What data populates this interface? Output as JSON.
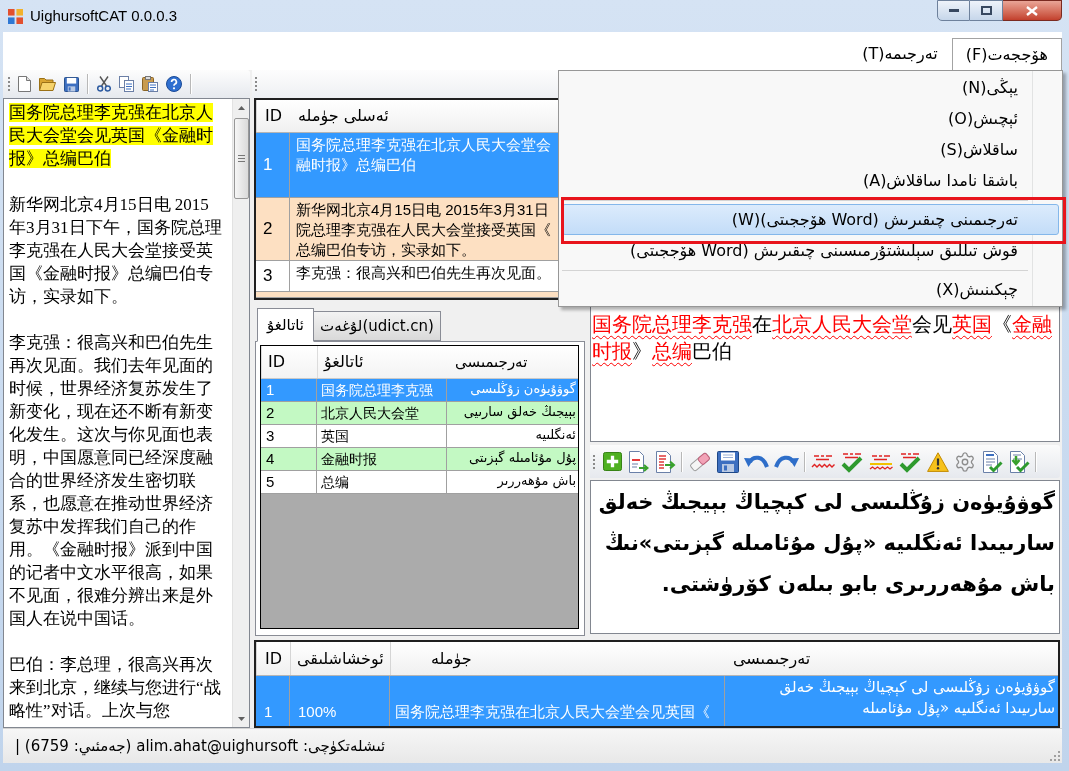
{
  "window": {
    "title": "UighursoftCAT 0.0.0.3"
  },
  "menu_bar": [
    {
      "label": "ھۆججەت(F)",
      "selected": true
    },
    {
      "label": "تەرجىمە(T)",
      "selected": false
    }
  ],
  "open_menu": {
    "items": [
      {
        "kind": "item",
        "label": "يېڭى(N)",
        "selected": false,
        "outlined": false
      },
      {
        "kind": "item",
        "label": "ئېچىش(O)",
        "selected": false,
        "outlined": false
      },
      {
        "kind": "item",
        "label": "ساقلاش(S)",
        "selected": false,
        "outlined": false
      },
      {
        "kind": "item",
        "label": "باشقا نامدا ساقلاش(A)",
        "selected": false,
        "outlined": false
      },
      {
        "kind": "separator"
      },
      {
        "kind": "item",
        "label": "تەرجىمىنى چىقىرىش (Word ھۆججىتى)(W)",
        "selected": true,
        "outlined": true
      },
      {
        "kind": "item",
        "label": "قوش تىللىق سېلىشتۇرمىسىنى چىقىرىش (Word ھۆججىتى)",
        "selected": false,
        "outlined": false
      },
      {
        "kind": "separator"
      },
      {
        "kind": "item",
        "label": "چېكىنىش(X)",
        "selected": false,
        "outlined": false
      }
    ]
  },
  "source_document": {
    "paragraphs": [
      {
        "text": "国务院总理李克强在北京人民大会堂会见英国《金融时报》总编巴伯",
        "highlighted": true
      },
      {
        "text": "新华网北京4月15日电 2015年3月31日下午，国务院总理李克强在人民大会堂接受英国《金融时报》总编巴伯专访，实录如下。",
        "highlighted": false
      },
      {
        "text": "李克强：很高兴和巴伯先生再次见面。我们去年见面的时候，世界经济复苏发生了新变化，现在还不断有新变化发生。这次与你见面也表明，中国愿意同已经深度融合的世界经济发生密切联系，也愿意在推动世界经济复苏中发挥我们自己的作用。《金融时报》派到中国的记者中文水平很高，如果不见面，很难分辨出来是外国人在说中国话。",
        "highlighted": false
      },
      {
        "text": "巴伯：李总理，很高兴再次来到北京，继续与您进行“战略性”对话。上次与您",
        "highlighted": false
      }
    ]
  },
  "segments_table": {
    "columns": [
      "ئەسلى جۈملە",
      "ID"
    ],
    "rows": [
      {
        "id": "1",
        "lines": [
          "国务院总理李克强在北京人民大会堂会",
          "融时报》总编巴伯"
        ],
        "selected": true
      },
      {
        "id": "2",
        "lines": [
          "新华网北京4月15日电 2015年3月31日",
          "院总理李克强在人民大会堂接受英国《",
          "总编巴伯专访，实录如下。"
        ],
        "selected": false
      },
      {
        "id": "3",
        "lines": [
          "李克强：很高兴和巴伯先生再次见面。"
        ],
        "selected": false
      },
      {
        "selected": false
      }
    ]
  },
  "terms_panel": {
    "tabs": [
      {
        "label": "لۇغەت(udict.cn)",
        "selected": false
      },
      {
        "label": "ئاتالغۇ",
        "selected": true
      }
    ],
    "columns": [
      "تەرجىمىسى",
      "ئاتالغۇ",
      "ID"
    ],
    "rows": [
      {
        "id": "1",
        "term": "国务院总理李克强",
        "translation": "گوۋۇيۈەن زۇڭلىسى",
        "selected": true
      },
      {
        "id": "2",
        "term": "北京人民大会堂",
        "translation": "بېيجىڭ خەلق سارىيى",
        "selected": false
      },
      {
        "id": "3",
        "term": "英国",
        "translation": "ئەنگلىيە",
        "selected": false
      },
      {
        "id": "4",
        "term": "金融时报",
        "translation": "پۇل مۇئامىلە گېزىتى",
        "selected": false
      },
      {
        "id": "5",
        "term": "总编",
        "translation": "باش مۇھەررىر",
        "selected": false
      }
    ]
  },
  "source_segment": {
    "text": "**国务院总理李克强**在**北京人民大会堂**会见**英国**《**金融时报**》**总编**巴伯"
  },
  "target_segment": {
    "text": "گوۋۇيۈەن زۇڭلىسى لى كېچياڭ بېيجىڭ خەلق سارىيىدا ئەنگلىيە «پۇل مۇئامىلە گېزىتى»نىڭ باش مۇھەررىرى بابو بىلەن كۆرۈشتى."
  },
  "matches_table": {
    "columns": [
      "تەرجىمىسى",
      "جۈملە",
      "ئوخشاشلىقى",
      "ID"
    ],
    "rows": [
      {
        "id": "1",
        "similarity": "100%",
        "sentence": "国务院总理李克强在北京人民大会堂会见英国《",
        "translation_lines": [
          "گوۋۇيۈەن زۇڭلىسى لى كېچياڭ بېيجىڭ خەلق",
          "سارىيىدا ئەنگلىيە «پۇل مۇئامىلە"
        ],
        "selected": true
      }
    ]
  },
  "status_bar": {
    "text": "ئىشلەتكۈچى: alim.ahat@uighursoft (جەمئىي: 6759) |"
  }
}
